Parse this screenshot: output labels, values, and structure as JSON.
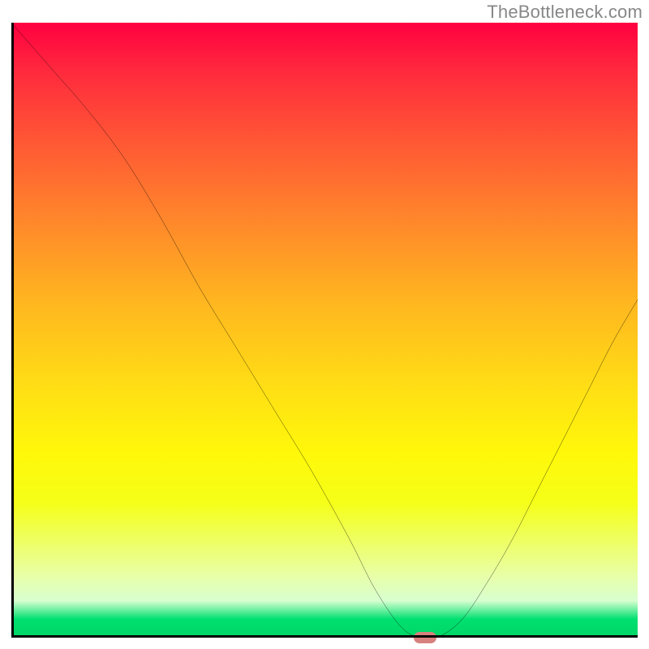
{
  "attribution": "TheBottleneck.com",
  "chart_data": {
    "type": "line",
    "title": "",
    "xlabel": "",
    "ylabel": "",
    "xlim": [
      0,
      100
    ],
    "ylim": [
      0,
      100
    ],
    "grid": false,
    "legend": false,
    "series": [
      {
        "name": "curve",
        "x": [
          0,
          6,
          12,
          18,
          24,
          30,
          36,
          42,
          48,
          54,
          58,
          62,
          65,
          68,
          72,
          76,
          80,
          84,
          88,
          92,
          96,
          100
        ],
        "y": [
          100,
          93,
          86,
          78,
          68,
          57,
          47,
          37,
          27,
          16,
          8,
          2,
          0,
          0,
          3,
          9,
          16,
          24,
          32,
          40,
          48,
          55
        ]
      }
    ],
    "marker": {
      "x": 66,
      "y": 0
    },
    "background_gradient_stops": [
      {
        "pos": 0,
        "color": "#ff0040"
      },
      {
        "pos": 33,
        "color": "#ff8a2a"
      },
      {
        "pos": 60,
        "color": "#ffe014"
      },
      {
        "pos": 90,
        "color": "#e8ffa8"
      },
      {
        "pos": 100,
        "color": "#00d666"
      }
    ]
  }
}
